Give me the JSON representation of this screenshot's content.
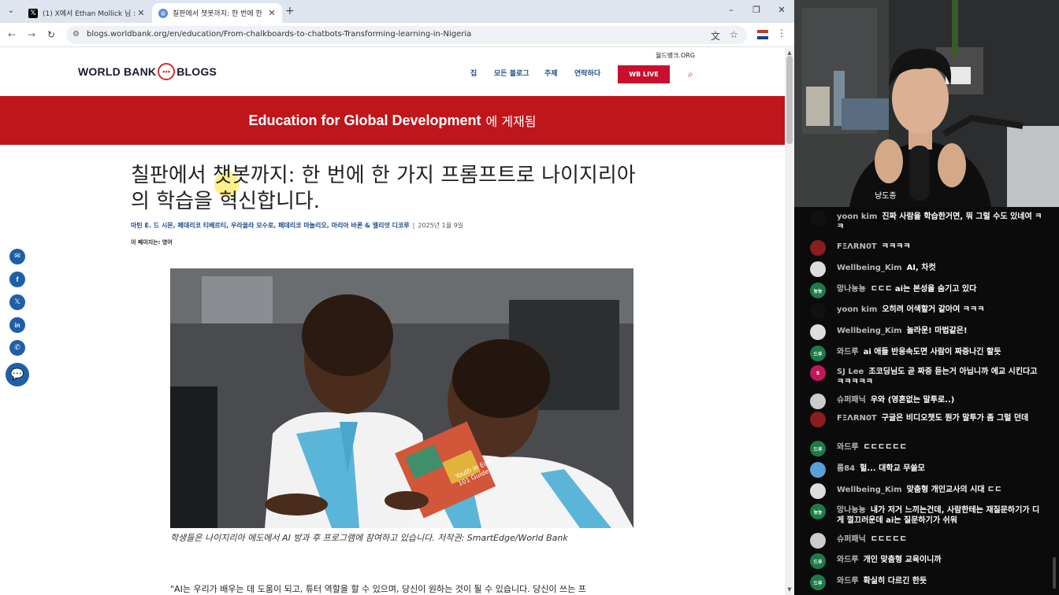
{
  "browser": {
    "tabs": [
      {
        "title": "(1) X에서 Ethan Mollick 님 : \"I",
        "favicon": "x-logo",
        "active": false
      },
      {
        "title": "칠판에서 챗봇까지: 한 번에 한",
        "favicon": "globe-icon",
        "active": true
      }
    ],
    "new_tab": "+",
    "url": "blogs.worldbank.org/en/education/From-chalkboards-to-chatbots-Transforming-learning-in-Nigeria"
  },
  "site": {
    "logo_left": "WORLD BANK",
    "logo_right": "BLOGS",
    "org_link": "월드뱅크.ORG",
    "nav": [
      "집",
      "모든 블로그",
      "주제",
      "연락하다"
    ],
    "live_label": "WB LIVE",
    "accent": "#c0161a"
  },
  "hero": {
    "strong": "Education for Global Development",
    "suffix": "에 게재됨"
  },
  "article": {
    "title": "칠판에서 챗봇까지: 한 번에 한 가지 프롬프트로 나이지리아의 학습을 혁신합니다.",
    "authors": "마틴 E. 드 시몬, 페데리코 티베르티, 우라올라 모수로, 페데리코 마놀리오, 마리아 바론 & 엘리엇 디코루",
    "date": "2025년 1월 9일",
    "language_note": "이 페이지는: 영어",
    "caption": "학생들은 나이지리아 에도에서 AI 방과 후 프로그램에 참여하고 있습니다. 저작권: SmartEdge/World Bank",
    "quote": "\"AI는 우리가 배우는 데 도움이 되고, 튜터 역할을 할 수 있으며, 당신이 원하는 것이 될 수 있습니다. 당신이 쓰는 프",
    "book_text": "Youth in Edo\n101 Guide"
  },
  "share": [
    "email-icon",
    "facebook-icon",
    "x-icon",
    "linkedin-icon",
    "whatsapp-icon",
    "comment-icon"
  ],
  "stream": {
    "overlay_text": "냥도종",
    "chat": [
      {
        "author": "yoon kim",
        "text": "진짜 사람을 학습한거면, 뭐 그럴 수도 있네여 ㅋㅋ",
        "avatar_color": "#111111",
        "avatar_text": ""
      },
      {
        "author": "FΞΛRN0T",
        "text": "ㅋㅋㅋㅋ",
        "avatar_color": "#8b1d1d",
        "avatar_text": ""
      },
      {
        "author": "Wellbeing_Kim",
        "text": "AI, 차컷",
        "avatar_color": "#dddddd",
        "avatar_text": ""
      },
      {
        "author": "망나뇽뇽",
        "text": "ㄷㄷㄷ ai는 본성을 숨기고 있다",
        "avatar_color": "#1e7a4a",
        "avatar_text": "뇽뇽"
      },
      {
        "author": "yoon kim",
        "text": "오히려 어색할거 같아여 ㅋㅋㅋ",
        "avatar_color": "#111111",
        "avatar_text": ""
      },
      {
        "author": "Wellbeing_Kim",
        "text": "놀라운! 마법같은!",
        "avatar_color": "#dddddd",
        "avatar_text": ""
      },
      {
        "author": "와드루",
        "text": "ai 애들 반응속도면 사람이 짜증나긴 할듯",
        "avatar_color": "#1e7a4a",
        "avatar_text": "드루"
      },
      {
        "author": "SJ Lee",
        "text": "조코딩님도 곧 짜증 듣는거 아닙니까 에교 시킨다고 ㅋㅋㅋㅋㅋ",
        "avatar_color": "#c2185b",
        "avatar_text": "S"
      },
      {
        "author": "슈퍼패닉",
        "text": "우와 (영혼없는 말투로..)",
        "avatar_color": "#cccccc",
        "avatar_text": ""
      },
      {
        "author": "FΞΛRN0T",
        "text": "구글은 비디오챗도 뭔가 말투가 좀 그럴 던데",
        "avatar_color": "#8b1d1d",
        "avatar_text": ""
      },
      {
        "author": "와드루",
        "text": "ㄷㄷㄷㄷㄷㄷ",
        "avatar_color": "#1e7a4a",
        "avatar_text": "드루"
      },
      {
        "author": "롬84",
        "text": "헐... 대학교 무쓸모",
        "avatar_color": "#5aa0d8",
        "avatar_text": ""
      },
      {
        "author": "Wellbeing_Kim",
        "text": "맞춤형 개인교사의 시대 ㄷㄷ",
        "avatar_color": "#dddddd",
        "avatar_text": ""
      },
      {
        "author": "망나뇽뇽",
        "text": "내가 저거 느끼는건데, 사람한테는 재질문하기가 디게 껄끄러운데 ai는 질문하기가 쉬워",
        "avatar_color": "#1e7a4a",
        "avatar_text": "뇽뇽"
      },
      {
        "author": "슈퍼패닉",
        "text": "ㄷㄷㄷㄷㄷ",
        "avatar_color": "#cccccc",
        "avatar_text": ""
      },
      {
        "author": "와드루",
        "text": "개인 맞춤형 교육이니까",
        "avatar_color": "#1e7a4a",
        "avatar_text": "드루"
      },
      {
        "author": "와드루",
        "text": "확실히 다르긴 한듯",
        "avatar_color": "#1e7a4a",
        "avatar_text": "드루"
      }
    ]
  }
}
